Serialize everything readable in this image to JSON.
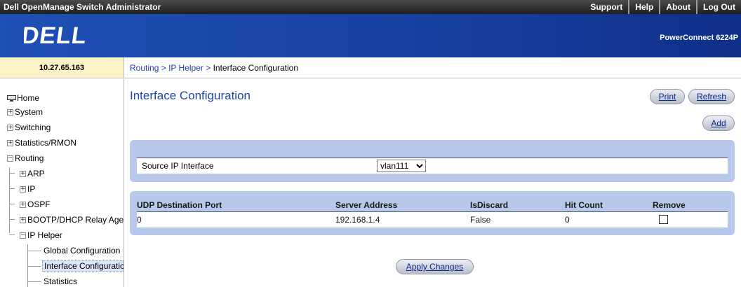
{
  "app": {
    "title": "Dell OpenManage Switch Administrator",
    "top_links": [
      "Support",
      "Help",
      "About",
      "Log Out"
    ],
    "brand": "DELL",
    "model": "PowerConnect 6224P"
  },
  "ip_address": "10.27.65.163",
  "breadcrumb": {
    "items": [
      "Routing",
      "IP Helper",
      "Interface Configuration"
    ],
    "sep": ">"
  },
  "sidebar": {
    "items": [
      "Home",
      "System",
      "Switching",
      "Statistics/RMON",
      "Routing",
      "ARP",
      "IP",
      "OSPF",
      "BOOTP/DHCP Relay Agent",
      "IP Helper",
      "Global Configuration",
      "Interface Configuration",
      "Statistics"
    ]
  },
  "page": {
    "title": "Interface Configuration",
    "print_label": "Print",
    "refresh_label": "Refresh",
    "add_label": "Add",
    "apply_label": "Apply Changes"
  },
  "source": {
    "label": "Source IP Interface",
    "value": "vlan111"
  },
  "table": {
    "columns": [
      "UDP Destination Port",
      "Server Address",
      "IsDiscard",
      "Hit Count",
      "Remove"
    ],
    "rows": [
      [
        "0",
        "192.168.1.4",
        "False",
        "0"
      ]
    ]
  },
  "colors": {
    "banner": "#1e4fb4",
    "panel": "#b7c8ea",
    "link": "#1d3ea0",
    "title": "#1f45a6"
  }
}
